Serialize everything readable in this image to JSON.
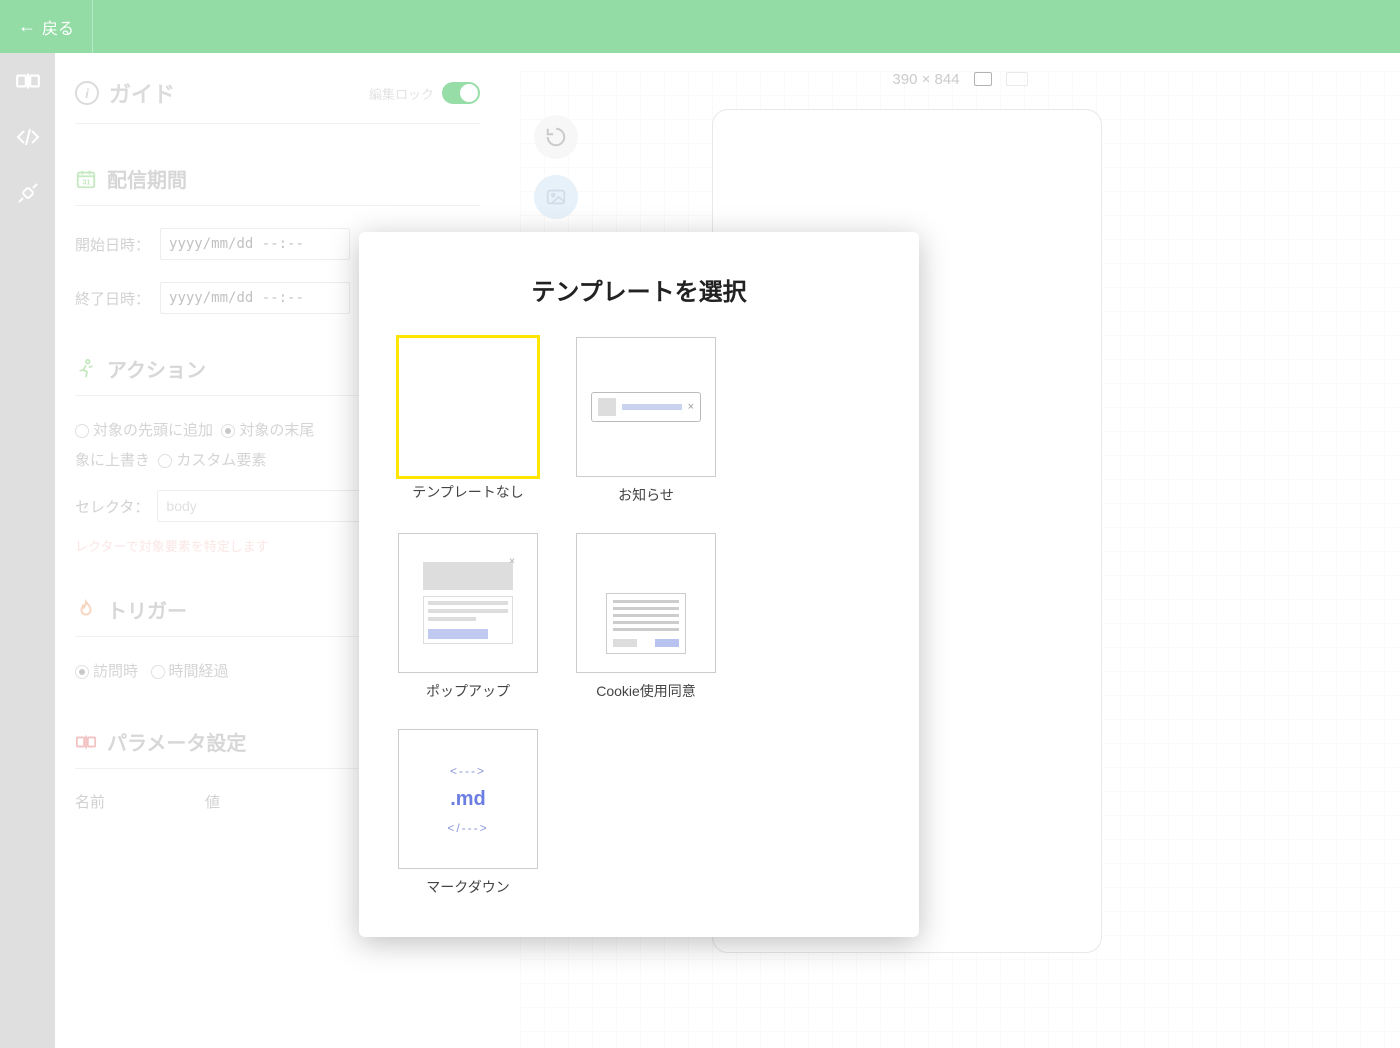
{
  "header": {
    "back": "戻る"
  },
  "sidebar": {
    "guide_title": "ガイド",
    "lock_label": "編集ロック",
    "period": {
      "title": "配信期間",
      "start_label": "開始日時：",
      "end_label": "終了日時：",
      "placeholder": "yyyy/mm/dd --:--"
    },
    "action": {
      "title": "アクション",
      "opt_prepend": "対象の先頭に追加",
      "opt_append": "対象の末尾",
      "opt_overwrite": "象に上書き",
      "opt_custom": "カスタム要素",
      "selector_label": "セレクタ：",
      "selector_value": "body",
      "hint": "レクターで対象要素を特定します"
    },
    "trigger": {
      "title": "トリガー",
      "opt_visit": "訪問時",
      "opt_time": "時間経過"
    },
    "params": {
      "title": "パラメータ設定",
      "col_name": "名前",
      "col_value": "値"
    }
  },
  "canvas": {
    "dimensions": "390 × 844"
  },
  "modal": {
    "title": "テンプレートを選択",
    "templates": {
      "none": "テンプレートなし",
      "notice": "お知らせ",
      "popup": "ポップアップ",
      "cookie": "Cookie使用同意",
      "markdown": "マークダウン"
    }
  }
}
